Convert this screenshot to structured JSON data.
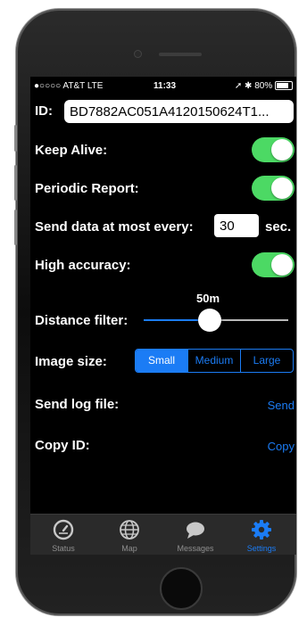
{
  "status_bar": {
    "carrier": "●○○○○ AT&T  LTE",
    "time": "11:33",
    "battery_text": "➚ ✱ 80%"
  },
  "settings": {
    "id_label": "ID:",
    "id_value": "BD7882AC051A4120150624T1...",
    "keep_alive_label": "Keep Alive:",
    "keep_alive_on": true,
    "periodic_report_label": "Periodic Report:",
    "periodic_report_on": true,
    "send_data_label": "Send data at most every:",
    "send_data_value": "30",
    "send_data_unit": "sec.",
    "high_accuracy_label": "High accuracy:",
    "high_accuracy_on": true,
    "distance_filter_label": "Distance filter:",
    "distance_filter_value": "50m",
    "distance_filter_fraction": 0.45,
    "image_size_label": "Image size:",
    "image_size_options": [
      "Small",
      "Medium",
      "Large"
    ],
    "image_size_selected": "Small",
    "send_log_label": "Send log file:",
    "send_log_action": "Send",
    "copy_id_label": "Copy ID:",
    "copy_id_action": "Copy"
  },
  "tabs": [
    {
      "label": "Status",
      "icon": "gauge-icon"
    },
    {
      "label": "Map",
      "icon": "globe-icon"
    },
    {
      "label": "Messages",
      "icon": "speech-bubble-icon"
    },
    {
      "label": "Settings",
      "icon": "gear-icon"
    }
  ],
  "active_tab": "Settings",
  "colors": {
    "accent": "#1b7cf5",
    "toggle_on": "#4cd964",
    "background": "#000000"
  }
}
